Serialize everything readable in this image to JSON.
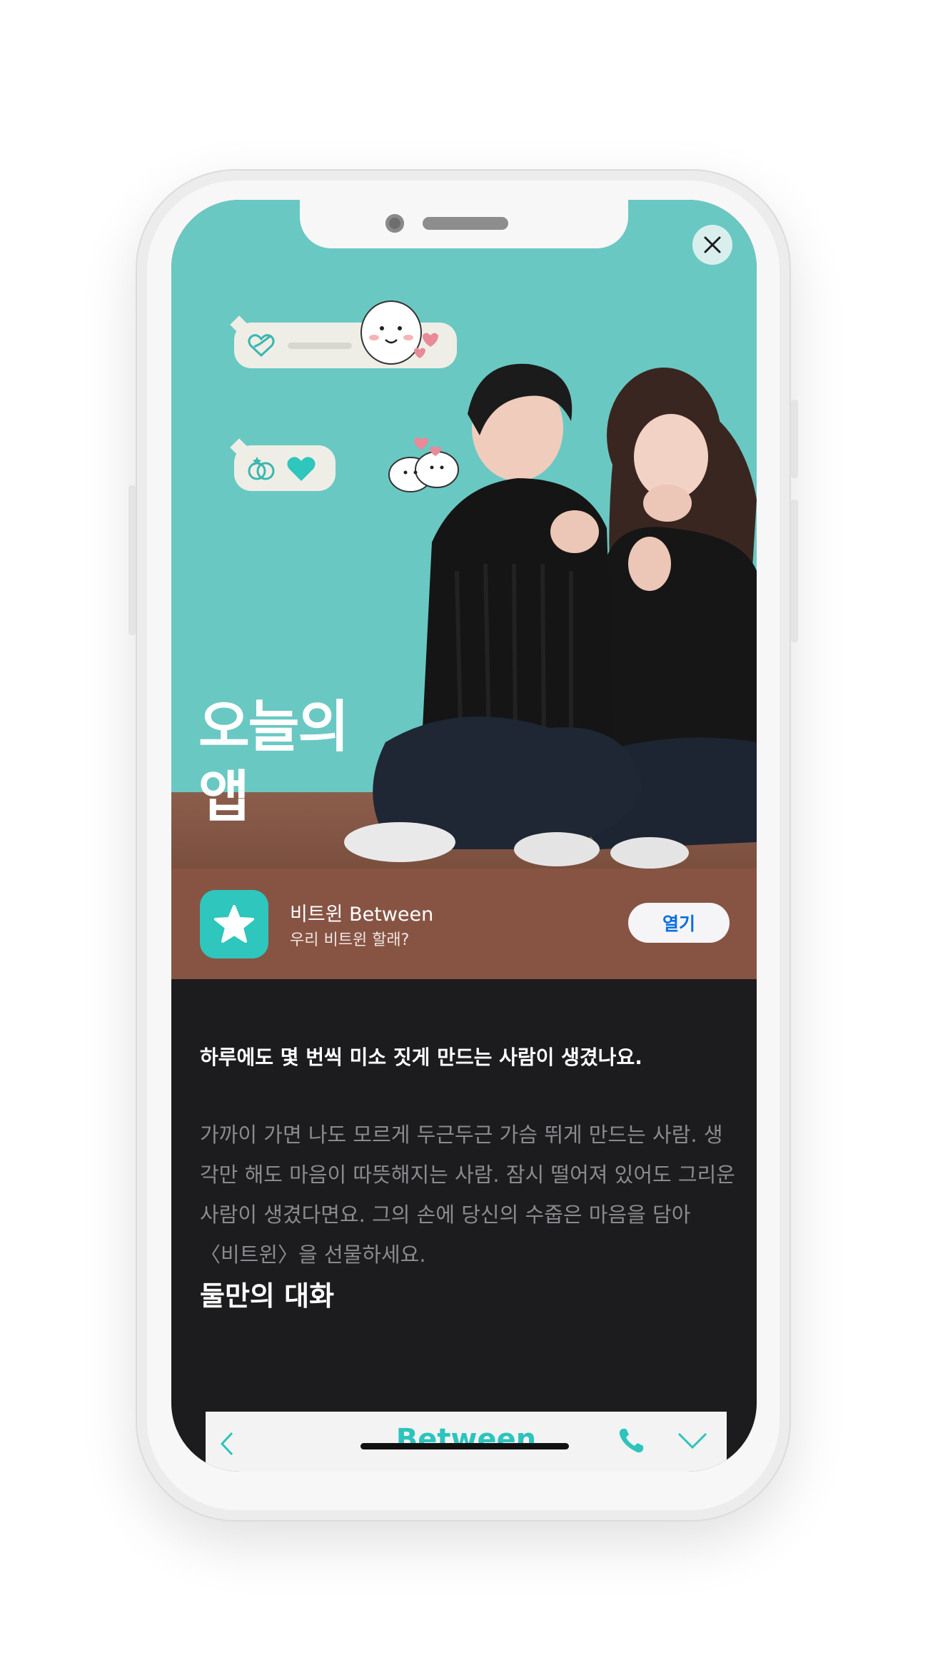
{
  "hero": {
    "title_line1": "오늘의",
    "title_line2": "앱"
  },
  "app": {
    "name": "비트윈 Between",
    "subtitle": "우리 비트윈 할래?",
    "open_label": "열기",
    "icon": "star-icon"
  },
  "article": {
    "headline": "하루에도 몇 번씩 미소 짓게 만드는 사람이 생겼나요.",
    "paragraph": "가까이 가면 나도 모르게 두근두근 가슴 뛰게 만드는 사람. 생각만 해도 마음이 따뜻해지는 사람. 잠시 떨어져 있어도 그리운 사람이 생겼다면요. 그의 손에 당신의 수줍은 마음을 담아 〈비트윈〉을 선물하세요.",
    "section_title": "둘만의 대화"
  },
  "chat_preview": {
    "title": "Between"
  },
  "colors": {
    "hero_bg": "#6ac8c3",
    "app_bar_bg": "#875444",
    "accent": "#2ec6bd",
    "dark_bg": "#1c1c1e",
    "button_text": "#0a6fe0"
  }
}
